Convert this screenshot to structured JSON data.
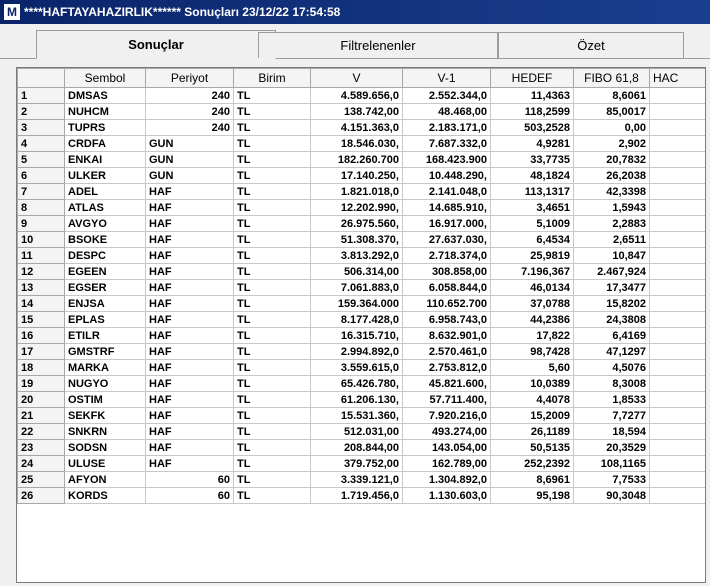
{
  "window": {
    "app_icon": "M",
    "title": "****HAFTAYAHAZIRLIK****** Sonuçları  23/12/22 17:54:58"
  },
  "tabs": [
    {
      "label": "Sonuçlar",
      "active": true
    },
    {
      "label": "Filtrelenenler",
      "active": false
    },
    {
      "label": "Özet",
      "active": false
    }
  ],
  "table": {
    "columns": [
      "",
      "Sembol",
      "Periyot",
      "Birim",
      "V",
      "V-1",
      "HEDEF",
      "FIBO 61,8",
      "HAC"
    ],
    "rows": [
      [
        "1",
        "DMSAS",
        "240",
        "TL",
        "4.589.656,0",
        "2.552.344,0",
        "11,4363",
        "8,6061"
      ],
      [
        "2",
        "NUHCM",
        "240",
        "TL",
        "138.742,00",
        "48.468,00",
        "118,2599",
        "85,0017"
      ],
      [
        "3",
        "TUPRS",
        "240",
        "TL",
        "4.151.363,0",
        "2.183.171,0",
        "503,2528",
        "0,00"
      ],
      [
        "4",
        "CRDFA",
        "GUN",
        "TL",
        "18.546.030,",
        "7.687.332,0",
        "4,9281",
        "2,902"
      ],
      [
        "5",
        "ENKAI",
        "GUN",
        "TL",
        "182.260.700",
        "168.423.900",
        "33,7735",
        "20,7832"
      ],
      [
        "6",
        "ULKER",
        "GUN",
        "TL",
        "17.140.250,",
        "10.448.290,",
        "48,1824",
        "26,2038"
      ],
      [
        "7",
        "ADEL",
        "HAF",
        "TL",
        "1.821.018,0",
        "2.141.048,0",
        "113,1317",
        "42,3398"
      ],
      [
        "8",
        "ATLAS",
        "HAF",
        "TL",
        "12.202.990,",
        "14.685.910,",
        "3,4651",
        "1,5943"
      ],
      [
        "9",
        "AVGYO",
        "HAF",
        "TL",
        "26.975.560,",
        "16.917.000,",
        "5,1009",
        "2,2883"
      ],
      [
        "10",
        "BSOKE",
        "HAF",
        "TL",
        "51.308.370,",
        "27.637.030,",
        "6,4534",
        "2,6511"
      ],
      [
        "11",
        "DESPC",
        "HAF",
        "TL",
        "3.813.292,0",
        "2.718.374,0",
        "25,9819",
        "10,847"
      ],
      [
        "12",
        "EGEEN",
        "HAF",
        "TL",
        "506.314,00",
        "308.858,00",
        "7.196,367",
        "2.467,924"
      ],
      [
        "13",
        "EGSER",
        "HAF",
        "TL",
        "7.061.883,0",
        "6.058.844,0",
        "46,0134",
        "17,3477"
      ],
      [
        "14",
        "ENJSA",
        "HAF",
        "TL",
        "159.364.000",
        "110.652.700",
        "37,0788",
        "15,8202"
      ],
      [
        "15",
        "EPLAS",
        "HAF",
        "TL",
        "8.177.428,0",
        "6.958.743,0",
        "44,2386",
        "24,3808"
      ],
      [
        "16",
        "ETILR",
        "HAF",
        "TL",
        "16.315.710,",
        "8.632.901,0",
        "17,822",
        "6,4169"
      ],
      [
        "17",
        "GMSTRF",
        "HAF",
        "TL",
        "2.994.892,0",
        "2.570.461,0",
        "98,7428",
        "47,1297"
      ],
      [
        "18",
        "MARKA",
        "HAF",
        "TL",
        "3.559.615,0",
        "2.753.812,0",
        "5,60",
        "4,5076"
      ],
      [
        "19",
        "NUGYO",
        "HAF",
        "TL",
        "65.426.780,",
        "45.821.600,",
        "10,0389",
        "8,3008"
      ],
      [
        "20",
        "OSTIM",
        "HAF",
        "TL",
        "61.206.130,",
        "57.711.400,",
        "4,4078",
        "1,8533"
      ],
      [
        "21",
        "SEKFK",
        "HAF",
        "TL",
        "15.531.360,",
        "7.920.216,0",
        "15,2009",
        "7,7277"
      ],
      [
        "22",
        "SNKRN",
        "HAF",
        "TL",
        "512.031,00",
        "493.274,00",
        "26,1189",
        "18,594"
      ],
      [
        "23",
        "SODSN",
        "HAF",
        "TL",
        "208.844,00",
        "143.054,00",
        "50,5135",
        "20,3529"
      ],
      [
        "24",
        "ULUSE",
        "HAF",
        "TL",
        "379.752,00",
        "162.789,00",
        "252,2392",
        "108,1165"
      ],
      [
        "25",
        "AFYON",
        "60",
        "TL",
        "3.339.121,0",
        "1.304.892,0",
        "8,6961",
        "7,7533"
      ],
      [
        "26",
        "KORDS",
        "60",
        "TL",
        "1.719.456,0",
        "1.130.603,0",
        "95,198",
        "90,3048"
      ]
    ]
  }
}
